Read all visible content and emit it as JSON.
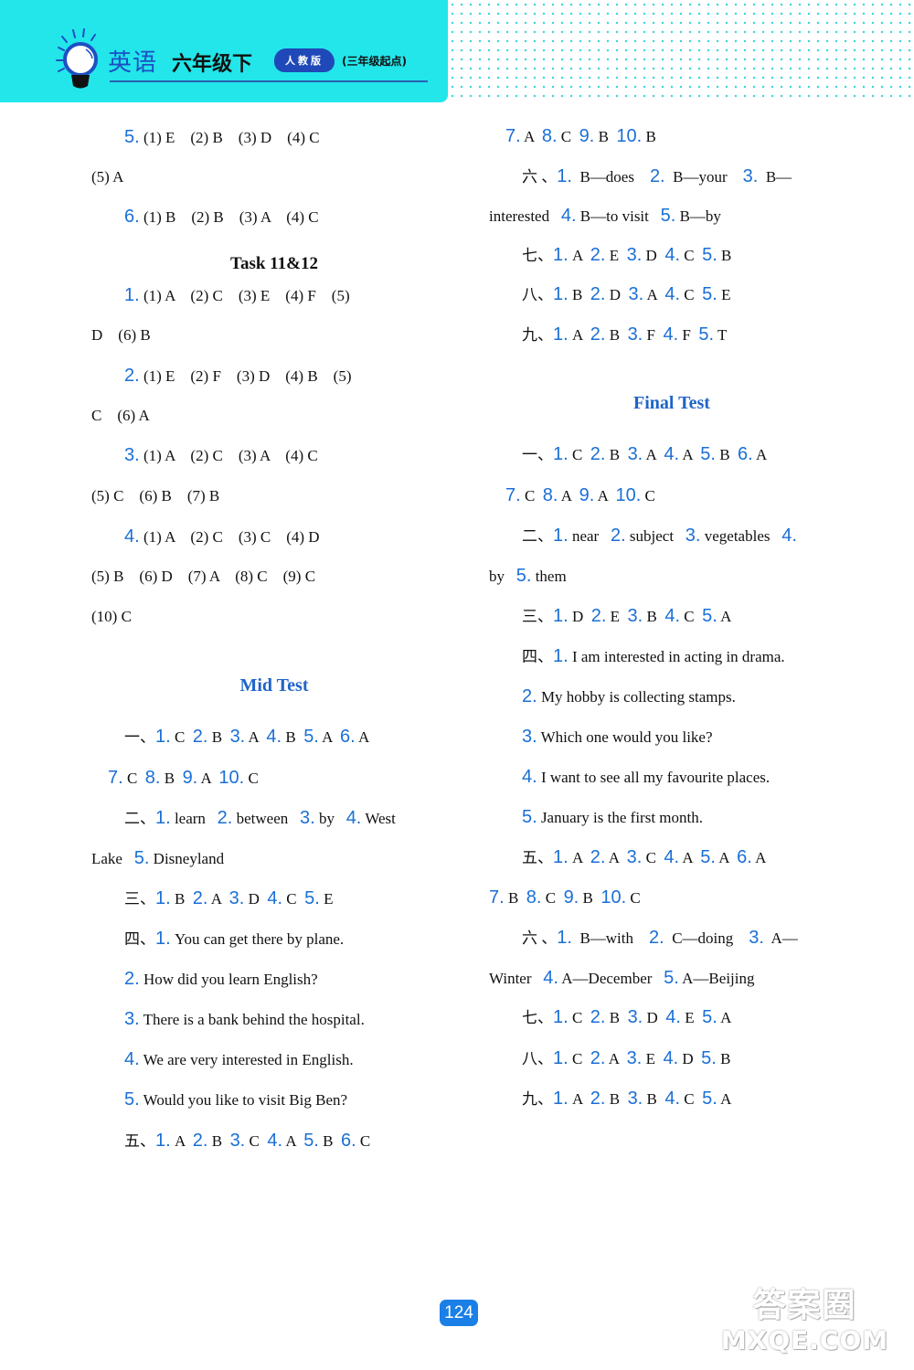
{
  "header": {
    "subject": "英语",
    "grade": "六年级下",
    "edition_badge": "人教版",
    "start_note": "(三年级起点)",
    "band_color": "#22e6ea",
    "accent_color": "#1a6fd6"
  },
  "left_column": [
    {
      "type": "line",
      "indent": true,
      "parts": [
        {
          "n": "5."
        },
        {
          "t": " (1) E    (2) B    (3) D    (4) C"
        }
      ]
    },
    {
      "type": "line",
      "indent": false,
      "parts": [
        {
          "t": "(5) A"
        }
      ]
    },
    {
      "type": "line",
      "indent": true,
      "parts": [
        {
          "n": "6."
        },
        {
          "t": " (1) B    (2) B    (3) A    (4) C"
        }
      ]
    },
    {
      "type": "heading",
      "style": "black",
      "text": "Task 11&12"
    },
    {
      "type": "line",
      "indent": true,
      "parts": [
        {
          "n": "1."
        },
        {
          "t": " (1) A    (2) C    (3) E    (4) F    (5)"
        }
      ]
    },
    {
      "type": "line",
      "indent": false,
      "parts": [
        {
          "t": "D    (6) B"
        }
      ]
    },
    {
      "type": "line",
      "indent": true,
      "parts": [
        {
          "n": "2."
        },
        {
          "t": " (1) E    (2) F    (3) D    (4) B    (5)"
        }
      ]
    },
    {
      "type": "line",
      "indent": false,
      "parts": [
        {
          "t": "C    (6) A"
        }
      ]
    },
    {
      "type": "line",
      "indent": true,
      "parts": [
        {
          "n": "3."
        },
        {
          "t": " (1) A    (2) C    (3) A    (4) C"
        }
      ]
    },
    {
      "type": "line",
      "indent": false,
      "parts": [
        {
          "t": "(5) C    (6) B    (7) B"
        }
      ]
    },
    {
      "type": "line",
      "indent": true,
      "parts": [
        {
          "n": "4."
        },
        {
          "t": " (1) A    (2) C    (3) C    (4) D"
        }
      ]
    },
    {
      "type": "line",
      "indent": false,
      "parts": [
        {
          "t": "(5) B    (6) D    (7) A    (8) C    (9) C"
        }
      ]
    },
    {
      "type": "line",
      "indent": false,
      "parts": [
        {
          "t": "(10) C"
        }
      ]
    },
    {
      "type": "heading",
      "style": "blue",
      "text": "Mid Test"
    },
    {
      "type": "line",
      "indent": true,
      "parts": [
        {
          "t": "一、"
        },
        {
          "n": "1."
        },
        {
          "t": " C  "
        },
        {
          "n": "2."
        },
        {
          "t": " B  "
        },
        {
          "n": "3."
        },
        {
          "t": " A  "
        },
        {
          "n": "4."
        },
        {
          "t": " B  "
        },
        {
          "n": "5."
        },
        {
          "t": " A  "
        },
        {
          "n": "6."
        },
        {
          "t": " A"
        }
      ]
    },
    {
      "type": "line",
      "indent": "half",
      "parts": [
        {
          "n": "7."
        },
        {
          "t": " C  "
        },
        {
          "n": "8."
        },
        {
          "t": " B  "
        },
        {
          "n": "9."
        },
        {
          "t": " A  "
        },
        {
          "n": "10."
        },
        {
          "t": " C"
        }
      ]
    },
    {
      "type": "line",
      "indent": true,
      "parts": [
        {
          "t": "二、"
        },
        {
          "n": "1."
        },
        {
          "t": " learn   "
        },
        {
          "n": "2."
        },
        {
          "t": " between   "
        },
        {
          "n": "3."
        },
        {
          "t": " by   "
        },
        {
          "n": "4."
        },
        {
          "t": " West"
        }
      ]
    },
    {
      "type": "line",
      "indent": false,
      "parts": [
        {
          "t": "Lake   "
        },
        {
          "n": "5."
        },
        {
          "t": " Disneyland"
        }
      ]
    },
    {
      "type": "line",
      "indent": true,
      "parts": [
        {
          "t": "三、"
        },
        {
          "n": "1."
        },
        {
          "t": " B  "
        },
        {
          "n": "2."
        },
        {
          "t": " A  "
        },
        {
          "n": "3."
        },
        {
          "t": " D  "
        },
        {
          "n": "4."
        },
        {
          "t": " C  "
        },
        {
          "n": "5."
        },
        {
          "t": " E"
        }
      ]
    },
    {
      "type": "line",
      "indent": true,
      "parts": [
        {
          "t": "四、"
        },
        {
          "n": "1."
        },
        {
          "t": " You can get there by plane."
        }
      ]
    },
    {
      "type": "line",
      "indent": true,
      "parts": [
        {
          "n": "2."
        },
        {
          "t": " How did you learn English?"
        }
      ]
    },
    {
      "type": "line",
      "indent": true,
      "parts": [
        {
          "n": "3."
        },
        {
          "t": " There is a bank behind the hospital."
        }
      ]
    },
    {
      "type": "line",
      "indent": true,
      "parts": [
        {
          "n": "4."
        },
        {
          "t": " We are very interested in English."
        }
      ]
    },
    {
      "type": "line",
      "indent": true,
      "parts": [
        {
          "n": "5."
        },
        {
          "t": " Would you like to visit Big Ben?"
        }
      ]
    },
    {
      "type": "line",
      "indent": true,
      "parts": [
        {
          "t": "五、"
        },
        {
          "n": "1."
        },
        {
          "t": " A  "
        },
        {
          "n": "2."
        },
        {
          "t": " B  "
        },
        {
          "n": "3."
        },
        {
          "t": " C  "
        },
        {
          "n": "4."
        },
        {
          "t": " A  "
        },
        {
          "n": "5."
        },
        {
          "t": " B  "
        },
        {
          "n": "6."
        },
        {
          "t": " C"
        }
      ]
    }
  ],
  "right_column": [
    {
      "type": "line",
      "indent": "half",
      "parts": [
        {
          "n": "7."
        },
        {
          "t": " A  "
        },
        {
          "n": "8."
        },
        {
          "t": " C  "
        },
        {
          "n": "9."
        },
        {
          "t": " B  "
        },
        {
          "n": "10."
        },
        {
          "t": " B"
        }
      ]
    },
    {
      "type": "line",
      "indent": true,
      "parts": [
        {
          "t": "六 、"
        },
        {
          "n": "1."
        },
        {
          "t": "  B—does    "
        },
        {
          "n": "2."
        },
        {
          "t": "  B—your    "
        },
        {
          "n": "3."
        },
        {
          "t": "  B—"
        }
      ]
    },
    {
      "type": "line",
      "indent": false,
      "parts": [
        {
          "t": "interested   "
        },
        {
          "n": "4."
        },
        {
          "t": " B—to visit   "
        },
        {
          "n": "5."
        },
        {
          "t": " B—by"
        }
      ]
    },
    {
      "type": "line",
      "indent": true,
      "parts": [
        {
          "t": "七、"
        },
        {
          "n": "1."
        },
        {
          "t": " A  "
        },
        {
          "n": "2."
        },
        {
          "t": " E  "
        },
        {
          "n": "3."
        },
        {
          "t": " D  "
        },
        {
          "n": "4."
        },
        {
          "t": " C  "
        },
        {
          "n": "5."
        },
        {
          "t": " B"
        }
      ]
    },
    {
      "type": "line",
      "indent": true,
      "parts": [
        {
          "t": "八、"
        },
        {
          "n": "1."
        },
        {
          "t": " B  "
        },
        {
          "n": "2."
        },
        {
          "t": " D  "
        },
        {
          "n": "3."
        },
        {
          "t": " A  "
        },
        {
          "n": "4."
        },
        {
          "t": " C  "
        },
        {
          "n": "5."
        },
        {
          "t": " E"
        }
      ]
    },
    {
      "type": "line",
      "indent": true,
      "parts": [
        {
          "t": "九、"
        },
        {
          "n": "1."
        },
        {
          "t": " A  "
        },
        {
          "n": "2."
        },
        {
          "t": " B  "
        },
        {
          "n": "3."
        },
        {
          "t": " F  "
        },
        {
          "n": "4."
        },
        {
          "t": " F  "
        },
        {
          "n": "5."
        },
        {
          "t": " T"
        }
      ]
    },
    {
      "type": "heading",
      "style": "blue",
      "text": "Final Test"
    },
    {
      "type": "line",
      "indent": true,
      "parts": [
        {
          "t": "一、"
        },
        {
          "n": "1."
        },
        {
          "t": " C  "
        },
        {
          "n": "2."
        },
        {
          "t": " B  "
        },
        {
          "n": "3."
        },
        {
          "t": " A  "
        },
        {
          "n": "4."
        },
        {
          "t": " A  "
        },
        {
          "n": "5."
        },
        {
          "t": " B  "
        },
        {
          "n": "6."
        },
        {
          "t": " A"
        }
      ]
    },
    {
      "type": "line",
      "indent": "half",
      "parts": [
        {
          "n": "7."
        },
        {
          "t": " C  "
        },
        {
          "n": "8."
        },
        {
          "t": " A  "
        },
        {
          "n": "9."
        },
        {
          "t": " A  "
        },
        {
          "n": "10."
        },
        {
          "t": " C"
        }
      ]
    },
    {
      "type": "line",
      "indent": true,
      "parts": [
        {
          "t": "二、"
        },
        {
          "n": "1."
        },
        {
          "t": " near   "
        },
        {
          "n": "2."
        },
        {
          "t": " subject   "
        },
        {
          "n": "3."
        },
        {
          "t": " vegetables   "
        },
        {
          "n": "4."
        }
      ]
    },
    {
      "type": "line",
      "indent": false,
      "parts": [
        {
          "t": "by   "
        },
        {
          "n": "5."
        },
        {
          "t": " them"
        }
      ]
    },
    {
      "type": "line",
      "indent": true,
      "parts": [
        {
          "t": "三、"
        },
        {
          "n": "1."
        },
        {
          "t": " D  "
        },
        {
          "n": "2."
        },
        {
          "t": " E  "
        },
        {
          "n": "3."
        },
        {
          "t": " B  "
        },
        {
          "n": "4."
        },
        {
          "t": " C  "
        },
        {
          "n": "5."
        },
        {
          "t": " A"
        }
      ]
    },
    {
      "type": "line",
      "indent": true,
      "parts": [
        {
          "t": "四、"
        },
        {
          "n": "1."
        },
        {
          "t": " I am interested in acting in drama."
        }
      ]
    },
    {
      "type": "line",
      "indent": true,
      "parts": [
        {
          "n": "2."
        },
        {
          "t": " My hobby is collecting stamps."
        }
      ]
    },
    {
      "type": "line",
      "indent": true,
      "parts": [
        {
          "n": "3."
        },
        {
          "t": " Which one would you like?"
        }
      ]
    },
    {
      "type": "line",
      "indent": true,
      "parts": [
        {
          "n": "4."
        },
        {
          "t": " I want to see all my favourite places."
        }
      ]
    },
    {
      "type": "line",
      "indent": true,
      "parts": [
        {
          "n": "5."
        },
        {
          "t": " January is the first month."
        }
      ]
    },
    {
      "type": "line",
      "indent": true,
      "parts": [
        {
          "t": "五、"
        },
        {
          "n": "1."
        },
        {
          "t": " A  "
        },
        {
          "n": "2."
        },
        {
          "t": " A  "
        },
        {
          "n": "3."
        },
        {
          "t": " C  "
        },
        {
          "n": "4."
        },
        {
          "t": " A  "
        },
        {
          "n": "5."
        },
        {
          "t": " A  "
        },
        {
          "n": "6."
        },
        {
          "t": " A"
        }
      ]
    },
    {
      "type": "line",
      "indent": false,
      "parts": [
        {
          "n": "7."
        },
        {
          "t": " B  "
        },
        {
          "n": "8."
        },
        {
          "t": " C  "
        },
        {
          "n": "9."
        },
        {
          "t": " B  "
        },
        {
          "n": "10."
        },
        {
          "t": " C"
        }
      ]
    },
    {
      "type": "line",
      "indent": true,
      "parts": [
        {
          "t": "六 、"
        },
        {
          "n": "1."
        },
        {
          "t": "  B—with    "
        },
        {
          "n": "2."
        },
        {
          "t": "  C—doing    "
        },
        {
          "n": "3."
        },
        {
          "t": "  A—"
        }
      ]
    },
    {
      "type": "line",
      "indent": false,
      "parts": [
        {
          "t": "Winter   "
        },
        {
          "n": "4."
        },
        {
          "t": " A—December   "
        },
        {
          "n": "5."
        },
        {
          "t": " A—Beijing"
        }
      ]
    },
    {
      "type": "line",
      "indent": true,
      "parts": [
        {
          "t": "七、"
        },
        {
          "n": "1."
        },
        {
          "t": " C  "
        },
        {
          "n": "2."
        },
        {
          "t": " B  "
        },
        {
          "n": "3."
        },
        {
          "t": " D  "
        },
        {
          "n": "4."
        },
        {
          "t": " E  "
        },
        {
          "n": "5."
        },
        {
          "t": " A"
        }
      ]
    },
    {
      "type": "line",
      "indent": true,
      "parts": [
        {
          "t": "八、"
        },
        {
          "n": "1."
        },
        {
          "t": " C  "
        },
        {
          "n": "2."
        },
        {
          "t": " A  "
        },
        {
          "n": "3."
        },
        {
          "t": " E  "
        },
        {
          "n": "4."
        },
        {
          "t": " D  "
        },
        {
          "n": "5."
        },
        {
          "t": " B"
        }
      ]
    },
    {
      "type": "line",
      "indent": true,
      "parts": [
        {
          "t": "九、"
        },
        {
          "n": "1."
        },
        {
          "t": " A  "
        },
        {
          "n": "2."
        },
        {
          "t": " B  "
        },
        {
          "n": "3."
        },
        {
          "t": " B  "
        },
        {
          "n": "4."
        },
        {
          "t": " C  "
        },
        {
          "n": "5."
        },
        {
          "t": " A"
        }
      ]
    }
  ],
  "footer": {
    "page_number": "124",
    "watermark_cn": "答案圈",
    "watermark_en": "MXQE.COM"
  }
}
